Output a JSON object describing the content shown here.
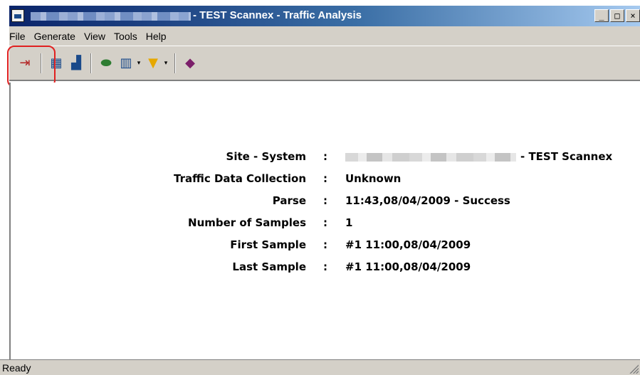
{
  "window": {
    "title": "- TEST Scannex - Traffic Analysis",
    "minimize_label": "_",
    "maximize_label": "□",
    "close_label": "×"
  },
  "menu": [
    {
      "label": "File"
    },
    {
      "label": "Generate"
    },
    {
      "label": "View"
    },
    {
      "label": "Tools"
    },
    {
      "label": "Help"
    }
  ],
  "toolbar": {
    "buttons": [
      {
        "icon": "exit-door-icon",
        "glyph": "⇥",
        "color": "#b22222"
      },
      {
        "icon": "chart-window-icon",
        "glyph": "▦",
        "color": "#1a4a8a"
      },
      {
        "icon": "report-chart-icon",
        "glyph": "▟",
        "color": "#1a4a8a"
      },
      {
        "icon": "database-icon",
        "glyph": "⬬",
        "color": "#2e7d32"
      },
      {
        "icon": "columns-icon",
        "glyph": "▥",
        "color": "#1a4a8a"
      },
      {
        "icon": "filter-icon",
        "glyph": "▼",
        "color": "#e6a800"
      },
      {
        "icon": "book-icon",
        "glyph": "◆",
        "color": "#7b1f6a"
      }
    ],
    "dropdown_arrow": "▾"
  },
  "info": [
    {
      "label": "Site - System",
      "value": "- TEST Scannex"
    },
    {
      "label": "Traffic Data Collection",
      "value": "Unknown"
    },
    {
      "label": "Parse",
      "value": "11:43,08/04/2009 - Success"
    },
    {
      "label": "Number of Samples",
      "value": "1"
    },
    {
      "label": "First Sample",
      "value": "#1 11:00,08/04/2009"
    },
    {
      "label": "Last Sample",
      "value": "#1 11:00,08/04/2009"
    }
  ],
  "separator": ":",
  "status": {
    "text": "Ready"
  },
  "colors": {
    "highlight": "#e02020",
    "title_bar": "#0a246a"
  }
}
